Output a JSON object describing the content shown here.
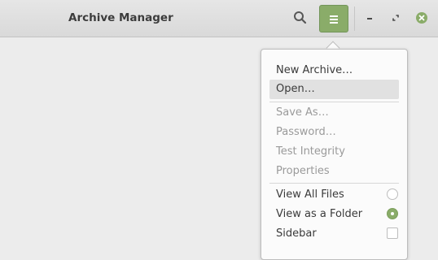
{
  "window": {
    "title": "Archive Manager"
  },
  "headerbar": {
    "search_icon": "search-icon",
    "menu_icon": "hamburger-menu-icon",
    "accent_color": "#8aac69",
    "minimize_icon": "minimize-icon",
    "maximize_icon": "maximize-icon",
    "close_icon": "close-icon"
  },
  "menu": {
    "group1": [
      {
        "label": "New Archive…",
        "enabled": true
      },
      {
        "label": "Open…",
        "enabled": true,
        "hovered": true
      }
    ],
    "group2": [
      {
        "label": "Save As…",
        "enabled": false
      },
      {
        "label": "Password…",
        "enabled": false
      },
      {
        "label": "Test Integrity",
        "enabled": false
      },
      {
        "label": "Properties",
        "enabled": false
      }
    ],
    "group3": [
      {
        "label": "View All Files",
        "control": "radio",
        "selected": false
      },
      {
        "label": "View as a Folder",
        "control": "radio",
        "selected": true
      },
      {
        "label": "Sidebar",
        "control": "checkbox",
        "checked": false
      }
    ]
  }
}
